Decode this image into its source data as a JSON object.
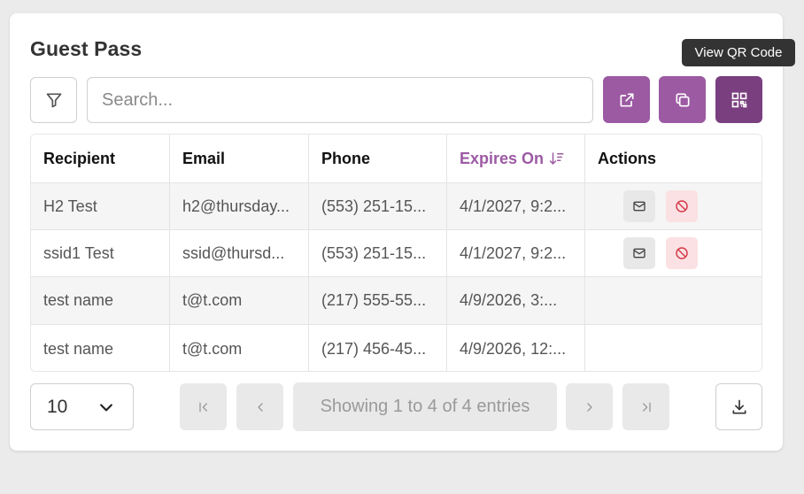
{
  "panel": {
    "title": "Guest Pass"
  },
  "tooltip": {
    "text": "View QR Code"
  },
  "toolbar": {
    "filter_icon": "filter-icon",
    "search_placeholder": "Search...",
    "search_value": "",
    "buttons": [
      {
        "icon": "external-link-icon"
      },
      {
        "icon": "copy-icon"
      },
      {
        "icon": "qr-code-icon"
      }
    ],
    "accent": "#9c5aa3",
    "accent_dark": "#7a3f7f"
  },
  "table": {
    "headers": [
      "Recipient",
      "Email",
      "Phone",
      "Expires On",
      "Actions"
    ],
    "sorted_column": "Expires On",
    "sort_direction": "descending",
    "rows": [
      {
        "recipient": "H2 Test",
        "email": "h2@thursday...",
        "phone": "(553) 251-15...",
        "expires": "4/1/2027, 9:2...",
        "actions": true
      },
      {
        "recipient": "ssid1 Test",
        "email": "ssid@thursd...",
        "phone": "(553) 251-15...",
        "expires": "4/1/2027, 9:2...",
        "actions": true
      },
      {
        "recipient": "test name",
        "email": "t@t.com",
        "phone": "(217) 555-55...",
        "expires": "4/9/2026, 3:...",
        "actions": false
      },
      {
        "recipient": "test name",
        "email": "t@t.com",
        "phone": "(217) 456-45...",
        "expires": "4/9/2026, 12:...",
        "actions": false
      }
    ]
  },
  "pagination": {
    "page_size": "10",
    "info": "Showing 1 to 4 of 4 entries"
  }
}
